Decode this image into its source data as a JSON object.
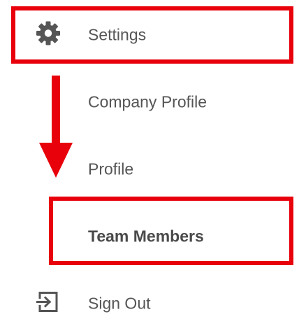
{
  "menu": {
    "items": [
      {
        "id": "settings",
        "label": "Settings",
        "icon": "gear-icon"
      },
      {
        "id": "company-profile",
        "label": "Company Profile"
      },
      {
        "id": "profile",
        "label": "Profile"
      },
      {
        "id": "team-members",
        "label": "Team Members",
        "emphasis": "bold"
      },
      {
        "id": "sign-out",
        "label": "Sign Out",
        "icon": "sign-out-icon"
      }
    ]
  },
  "annotations": {
    "color": "#e8000b",
    "highlighted": [
      "settings",
      "team-members"
    ],
    "arrow": "down"
  },
  "colors": {
    "text": "#555555",
    "icon": "#555555"
  }
}
